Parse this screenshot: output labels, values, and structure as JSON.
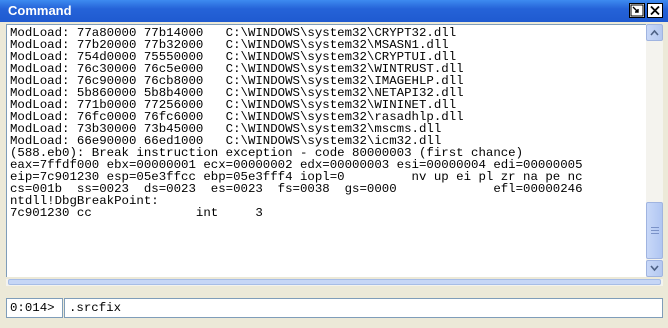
{
  "window": {
    "title": "Command"
  },
  "output": {
    "lines": [
      "ModLoad: 77a80000 77b14000   C:\\WINDOWS\\system32\\CRYPT32.dll",
      "ModLoad: 77b20000 77b32000   C:\\WINDOWS\\system32\\MSASN1.dll",
      "ModLoad: 754d0000 75550000   C:\\WINDOWS\\system32\\CRYPTUI.dll",
      "ModLoad: 76c30000 76c5e000   C:\\WINDOWS\\system32\\WINTRUST.dll",
      "ModLoad: 76c90000 76cb8000   C:\\WINDOWS\\system32\\IMAGEHLP.dll",
      "ModLoad: 5b860000 5b8b4000   C:\\WINDOWS\\system32\\NETAPI32.dll",
      "ModLoad: 771b0000 77256000   C:\\WINDOWS\\system32\\WININET.dll",
      "ModLoad: 76fc0000 76fc6000   C:\\WINDOWS\\system32\\rasadhlp.dll",
      "ModLoad: 73b30000 73b45000   C:\\WINDOWS\\system32\\mscms.dll",
      "ModLoad: 66e90000 66ed1000   C:\\WINDOWS\\system32\\icm32.dll",
      "(588.eb0): Break instruction exception - code 80000003 (first chance)",
      "eax=7ffdf000 ebx=00000001 ecx=00000002 edx=00000003 esi=00000004 edi=00000005",
      "eip=7c901230 esp=05e3ffcc ebp=05e3fff4 iopl=0         nv up ei pl zr na pe nc",
      "cs=001b  ss=0023  ds=0023  es=0023  fs=0038  gs=0000             efl=00000246",
      "ntdll!DbgBreakPoint:",
      "7c901230 cc              int     3"
    ]
  },
  "prompt": {
    "label": "0:014>"
  },
  "command_input": {
    "value": ".srcfix"
  },
  "icons": {
    "dock": "dock-icon",
    "close": "close-icon",
    "scroll_up": "scroll-up-arrow-icon",
    "scroll_down": "scroll-down-arrow-icon"
  },
  "colors": {
    "titlebar": "#2563d8",
    "title_text": "#ffffff",
    "background": "#ece9d8",
    "output_bg": "#ffffff",
    "scrollbar": "#c6d6f6"
  }
}
